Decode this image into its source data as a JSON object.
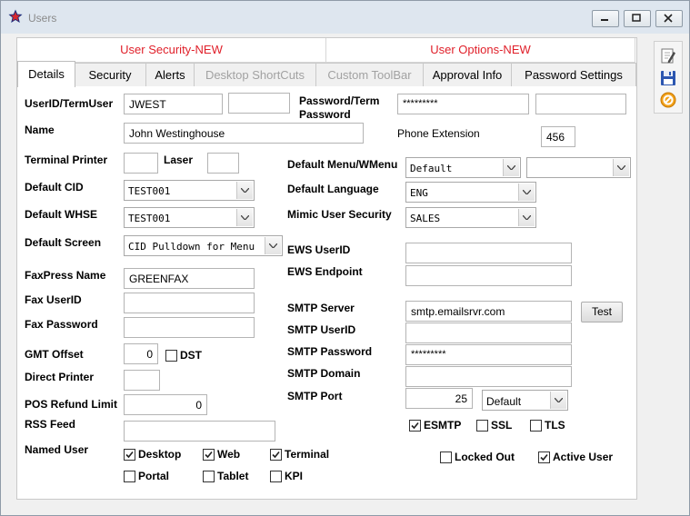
{
  "window": {
    "title": "Users"
  },
  "top_tabs": [
    "User Security-NEW",
    "User Options-NEW"
  ],
  "tabs": [
    "Details",
    "Security",
    "Alerts",
    "Desktop ShortCuts",
    "Custom ToolBar",
    "Approval Info",
    "Password Settings"
  ],
  "labels": {
    "userid": "UserID/TermUser",
    "password": "Password/Term Password",
    "name": "Name",
    "phone_ext": "Phone Extension",
    "terminal_printer": "Terminal Printer",
    "laser": "Laser",
    "default_menu": "Default Menu/WMenu",
    "default_cid": "Default CID",
    "default_language": "Default Language",
    "default_whse": "Default WHSE",
    "mimic": "Mimic User Security",
    "default_screen": "Default Screen",
    "ews_userid": "EWS UserID",
    "ews_endpoint": "EWS Endpoint",
    "faxpress": "FaxPress Name",
    "fax_userid": "Fax UserID",
    "fax_password": "Fax Password",
    "smtp_server": "SMTP Server",
    "smtp_userid": "SMTP UserID",
    "smtp_password": "SMTP Password",
    "smtp_domain": "SMTP Domain",
    "smtp_port": "SMTP Port",
    "gmt_offset": "GMT Offset",
    "direct_printer": "Direct Printer",
    "pos_refund": "POS Refund Limit",
    "rss_feed": "RSS Feed",
    "named_user": "Named User"
  },
  "fields": {
    "userid": "JWEST",
    "userid2": "",
    "password": "*********",
    "password2": "",
    "name": "John Westinghouse",
    "phone_ext": "456",
    "terminal_printer": "",
    "laser": "",
    "default_menu": "Default",
    "default_menu2": "",
    "default_cid": "TEST001",
    "default_language": "ENG",
    "default_whse": "TEST001",
    "mimic": "SALES",
    "default_screen": "CID Pulldown for Menu",
    "ews_userid": "",
    "ews_endpoint": "",
    "faxpress": "GREENFAX",
    "fax_userid": "",
    "fax_password": "",
    "smtp_server": "smtp.emailsrvr.com",
    "smtp_userid": "",
    "smtp_password": "*********",
    "smtp_domain": "",
    "smtp_port": "25",
    "smtp_port_mode": "Default",
    "gmt_offset": "0",
    "direct_printer": "",
    "pos_refund": "0",
    "rss_feed": ""
  },
  "buttons": {
    "test": "Test"
  },
  "checkboxes": {
    "dst": {
      "label": "DST",
      "checked": false
    },
    "esmtp": {
      "label": "ESMTP",
      "checked": true
    },
    "ssl": {
      "label": "SSL",
      "checked": false
    },
    "tls": {
      "label": "TLS",
      "checked": false
    },
    "desktop": {
      "label": "Desktop",
      "checked": true
    },
    "web": {
      "label": "Web",
      "checked": true
    },
    "terminal": {
      "label": "Terminal",
      "checked": true
    },
    "portal": {
      "label": "Portal",
      "checked": false
    },
    "tablet": {
      "label": "Tablet",
      "checked": false
    },
    "kpi": {
      "label": "KPI",
      "checked": false
    },
    "locked_out": {
      "label": "Locked Out",
      "checked": false
    },
    "active_user": {
      "label": "Active User",
      "checked": true
    }
  },
  "colors": {
    "accent_red": "#e0202a",
    "disabled_gray": "#a2a2a2"
  },
  "icons": [
    "star-app-icon",
    "minimize-icon",
    "maximize-icon",
    "close-icon",
    "edit-icon",
    "save-icon",
    "cancel-icon"
  ]
}
